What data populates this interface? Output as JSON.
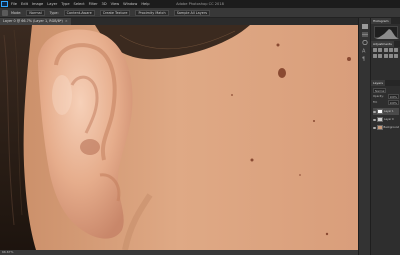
{
  "app": {
    "title": "Adobe Photoshop CC 2018",
    "menu": [
      "PS",
      "File",
      "Edit",
      "Image",
      "Layer",
      "Type",
      "Select",
      "Filter",
      "3D",
      "View",
      "Window",
      "Help"
    ]
  },
  "options_bar": {
    "items": [
      "Mode:",
      "Normal",
      "Type:",
      "Content-Aware",
      "Create Texture",
      "Proximity Match",
      "Sample All Layers"
    ]
  },
  "document": {
    "tab_label": "Layer 0 @ 66.7% (Layer 1, RGB/8*)",
    "close_glyph": "×"
  },
  "status": {
    "text": "66.67%"
  },
  "panels": {
    "top_tabs": [
      "Histogram",
      "Info"
    ],
    "adjust_tabs": [
      "Adjustments",
      "Libraries"
    ],
    "layers_tabs": [
      "Layers",
      "Channels",
      "Paths"
    ],
    "blend_mode": "Normal",
    "opacity_label": "Opacity:",
    "opacity_value": "100%",
    "fill_label": "Fill:",
    "fill_value": "100%",
    "layers": [
      {
        "name": "Layer 1",
        "selected": true
      },
      {
        "name": "Layer 0",
        "selected": false
      },
      {
        "name": "Background",
        "selected": false
      }
    ]
  },
  "colors": {
    "accent": "#31a8ff",
    "skin": "#d9a07a"
  }
}
